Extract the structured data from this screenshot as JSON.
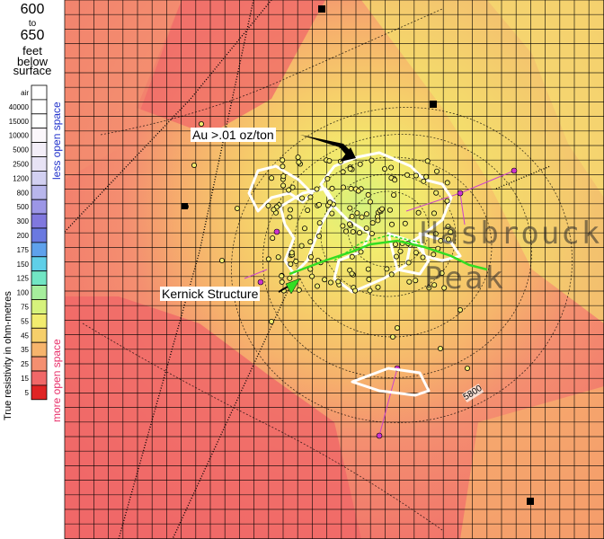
{
  "legend": {
    "depth_top": "600",
    "depth_to": "to",
    "depth_bottom": "650",
    "depth_unit": "feet",
    "depth_ref1": "below",
    "depth_ref2": "surface",
    "scale_entries": [
      {
        "label": "air",
        "color": "#ffffff"
      },
      {
        "label": "40000",
        "color": "#ffffff"
      },
      {
        "label": "15000",
        "color": "#ffffff"
      },
      {
        "label": "10000",
        "color": "#fbf7fb"
      },
      {
        "label": "5000",
        "color": "#f3eef8"
      },
      {
        "label": "2500",
        "color": "#e7e3f5"
      },
      {
        "label": "1200",
        "color": "#d2d0f1"
      },
      {
        "label": "800",
        "color": "#b8b6ec"
      },
      {
        "label": "500",
        "color": "#9c96e6"
      },
      {
        "label": "300",
        "color": "#8078de"
      },
      {
        "label": "200",
        "color": "#6a79e0"
      },
      {
        "label": "175",
        "color": "#5ea1ec"
      },
      {
        "label": "150",
        "color": "#5fcfe8"
      },
      {
        "label": "125",
        "color": "#71e6c4"
      },
      {
        "label": "100",
        "color": "#a6ee9c"
      },
      {
        "label": "75",
        "color": "#d6f27c"
      },
      {
        "label": "55",
        "color": "#f2ec6e"
      },
      {
        "label": "45",
        "color": "#f6cf6a"
      },
      {
        "label": "35",
        "color": "#f6b46c"
      },
      {
        "label": "25",
        "color": "#f48f70"
      },
      {
        "label": "15",
        "color": "#f06868"
      },
      {
        "label": "5",
        "color": "#e02424"
      }
    ],
    "less_label": "less open space",
    "less_color": "#2233cc",
    "more_label": "more open space",
    "more_color": "#e8306a",
    "axis_title": "True resistivity in ohm-metres"
  },
  "map": {
    "annotation_gold": "Au >.01 oz/ton",
    "annotation_kernick": "Kernick Structure",
    "peak_word1": "Hasbrouck",
    "peak_word2": "Peak",
    "contour_label": "5800",
    "colors": {
      "low_resistivity": "#f06868",
      "mid_resistivity": "#f6b46c",
      "high_resistivity": "#f2ec6e",
      "peak_core": "#d6f27c",
      "gold_outline": "#ffffff",
      "kernick_trace": "#33dd22",
      "drillhole_trace": "#cc44cc"
    }
  }
}
